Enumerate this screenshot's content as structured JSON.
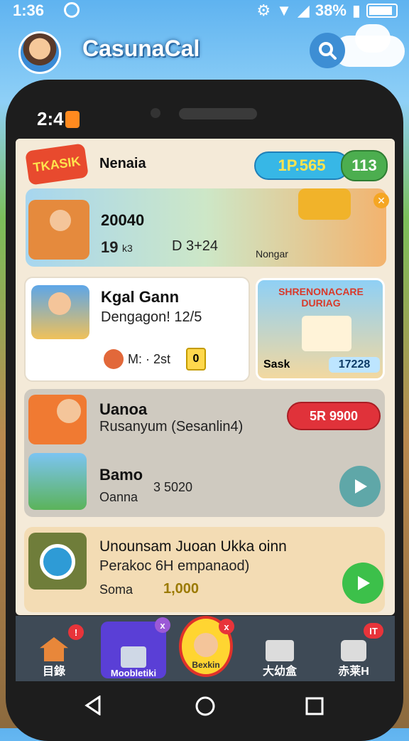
{
  "status_bar": {
    "time": "1:36",
    "battery": "38%"
  },
  "header": {
    "title": "CasunaCal"
  },
  "phone": {
    "time": "2:4"
  },
  "top_card": {
    "logo_text": "TKASIK",
    "name": "Nenaia",
    "coins": "1P.565",
    "gems": "113"
  },
  "banner": {
    "score": "20040",
    "stat_a": "19",
    "stat_a_suffix": "k3",
    "stat_b": "D 3+24",
    "label": "Nongar"
  },
  "game_card": {
    "title": "Kgal Gann",
    "subtitle": "Dengagon! 12/5",
    "meta": "M: · 2st",
    "meta_badge": "0"
  },
  "promo_card": {
    "title": "SHRENONACARE DURIAG",
    "left_stat": "Sask",
    "right_stat": "17228"
  },
  "list": [
    {
      "title": "Uanoa",
      "subtitle": "Rusanyum (Sesanlin4)",
      "action": "5R 9900"
    },
    {
      "title": "Bamo",
      "subtitle": "Oanna",
      "value": "3 5020"
    },
    {
      "title": "Unounsam Juoan Ukka oinn",
      "subtitle": "Perakoc 6H empanaod)",
      "meta": "Soma",
      "value": "1,000"
    }
  ],
  "nav": [
    {
      "label": "目錄",
      "badge": "!"
    },
    {
      "label": "Moobletiki",
      "badge": "x"
    },
    {
      "label": "Bexkin",
      "badge": "x"
    },
    {
      "label": "大幼盒",
      "badge": ""
    },
    {
      "label": "赤莱H",
      "badge": "IT"
    }
  ],
  "colors": {
    "accent_blue": "#37b7e6",
    "accent_green": "#4cae4f",
    "accent_red": "#e0323a"
  }
}
